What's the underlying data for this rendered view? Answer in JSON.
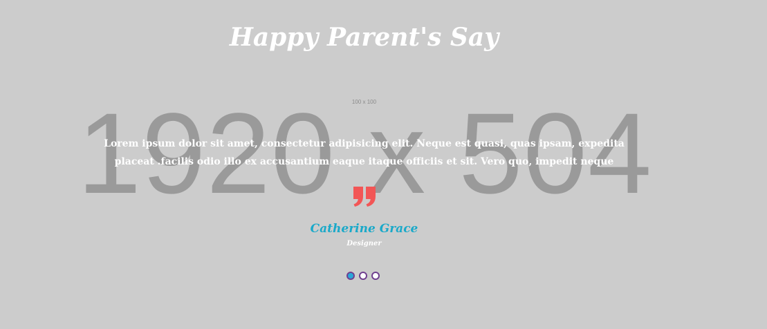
{
  "section": {
    "title": "Happy Parent's Say",
    "background_placeholder": "1920 x 504",
    "avatar_placeholder": "100 x 100"
  },
  "testimonial": {
    "quote": "Lorem ipsum dolor sit amet, consectetur adipisicing elit. Neque est quasi, quas ipsam, expedita placeat .facilis odio illo ex accusantium eaque itaque officiis et sit. Vero quo, impedit neque",
    "name": "Catherine Grace",
    "role": "Designer",
    "quote_icon": "quote-icon"
  },
  "carousel": {
    "dots": [
      {
        "label": "slide 1",
        "active": true
      },
      {
        "label": "slide 2",
        "active": false
      },
      {
        "label": "slide 3",
        "active": false
      }
    ]
  },
  "colors": {
    "background": "#cccccc",
    "accent_name": "#1aa9c9",
    "quote_icon": "#f25656",
    "dot_border": "#6f3f8f",
    "dot_active": "#2aa7d8"
  }
}
